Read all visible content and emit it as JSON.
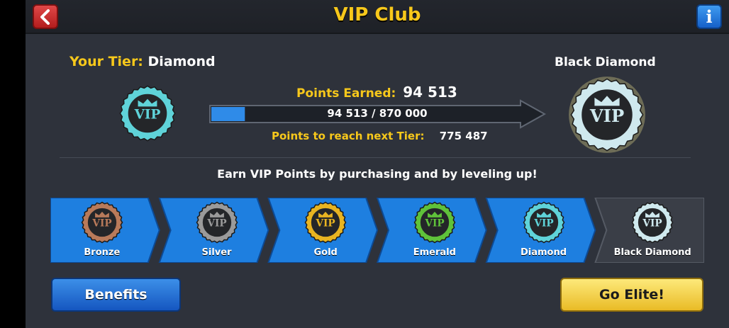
{
  "header": {
    "title": "VIP Club",
    "back_icon": "chevron-left-icon",
    "info_icon": "info-icon",
    "info_glyph": "i"
  },
  "current_tier": {
    "label": "Your Tier:",
    "name": "Diamond"
  },
  "next_tier": {
    "name": "Black Diamond"
  },
  "points": {
    "earned_label": "Points Earned:",
    "earned_value": "94 513",
    "progress_text": "94 513 / 870 000",
    "progress_fraction": 0.1086,
    "next_label": "Points to reach next Tier:",
    "next_value": "775 487"
  },
  "earn_message": "Earn VIP Points by purchasing and by leveling up!",
  "tiers": [
    {
      "name": "Bronze",
      "color": "#b87a5a"
    },
    {
      "name": "Silver",
      "color": "#9a9a9a"
    },
    {
      "name": "Gold",
      "color": "#e8b421"
    },
    {
      "name": "Emerald",
      "color": "#5fc23a"
    },
    {
      "name": "Diamond",
      "color": "#5fd3d9"
    },
    {
      "name": "Black Diamond",
      "color": "#cfe9ee"
    }
  ],
  "badge_text": "VIP",
  "buttons": {
    "benefits": "Benefits",
    "go_elite": "Go Elite!"
  },
  "colors": {
    "accent_yellow": "#f7c81b",
    "tier_blue": "#1e7fe0",
    "progress_blue": "#2f8be8"
  }
}
